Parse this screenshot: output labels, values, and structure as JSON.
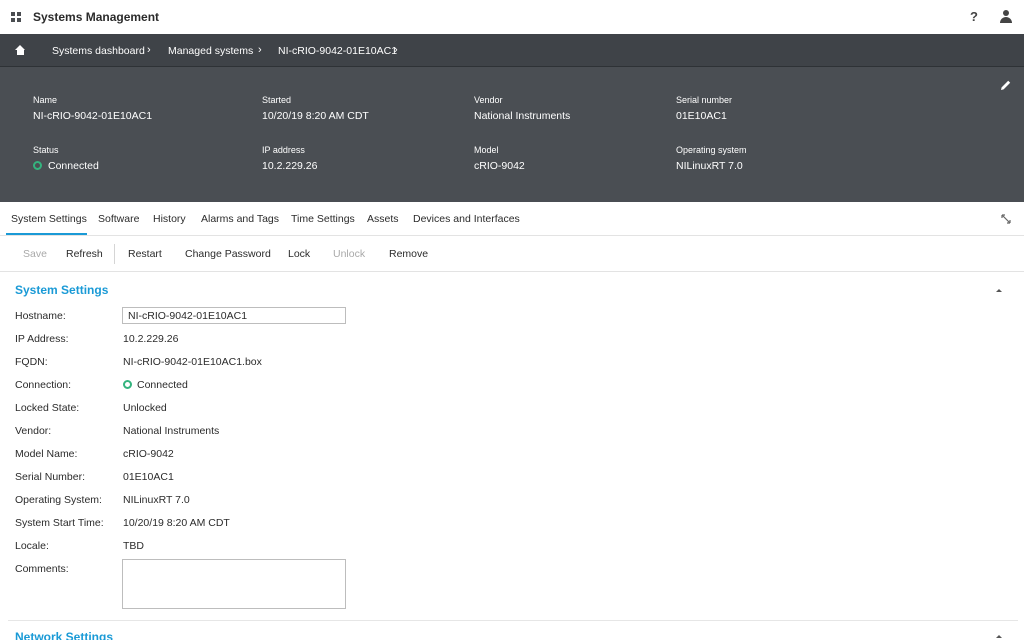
{
  "app": {
    "title": "Systems Management"
  },
  "header": {
    "help_glyph": "?"
  },
  "breadcrumb": [
    {
      "label": "Systems dashboard"
    },
    {
      "label": "Managed systems"
    },
    {
      "label": "NI-cRIO-9042-01E10AC1"
    }
  ],
  "breadcrumb_sep": "›",
  "info": {
    "name_label": "Name",
    "name_value": "NI-cRIO-9042-01E10AC1",
    "started_label": "Started",
    "started_value": "10/20/19 8:20 AM CDT",
    "vendor_label": "Vendor",
    "vendor_value": "National Instruments",
    "serial_label": "Serial number",
    "serial_value": "01E10AC1",
    "status_label": "Status",
    "status_value": "Connected",
    "ip_label": "IP address",
    "ip_value": "10.2.229.26",
    "model_label": "Model",
    "model_value": "cRIO-9042",
    "os_label": "Operating system",
    "os_value": "NILinuxRT 7.0"
  },
  "tabs": [
    {
      "label": "System Settings",
      "active": true
    },
    {
      "label": "Software"
    },
    {
      "label": "History"
    },
    {
      "label": "Alarms and Tags"
    },
    {
      "label": "Time Settings"
    },
    {
      "label": "Assets"
    },
    {
      "label": "Devices and Interfaces"
    }
  ],
  "toolbar": {
    "save": "Save",
    "refresh": "Refresh",
    "restart": "Restart",
    "change_password": "Change Password",
    "lock": "Lock",
    "unlock": "Unlock",
    "remove": "Remove"
  },
  "system_settings": {
    "title": "System Settings",
    "hostname_label": "Hostname:",
    "hostname_value": "NI-cRIO-9042-01E10AC1",
    "ip_label": "IP Address:",
    "ip_value": "10.2.229.26",
    "fqdn_label": "FQDN:",
    "fqdn_value": "NI-cRIO-9042-01E10AC1.box",
    "connection_label": "Connection:",
    "connection_value": "Connected",
    "locked_label": "Locked State:",
    "locked_value": "Unlocked",
    "vendor_label": "Vendor:",
    "vendor_value": "National Instruments",
    "model_label": "Model Name:",
    "model_value": "cRIO-9042",
    "serial_label": "Serial Number:",
    "serial_value": "01E10AC1",
    "os_label": "Operating System:",
    "os_value": "NILinuxRT 7.0",
    "start_label": "System Start Time:",
    "start_value": "10/20/19 8:20 AM CDT",
    "locale_label": "Locale:",
    "locale_value": "TBD",
    "comments_label": "Comments:",
    "comments_value": ""
  },
  "network_settings": {
    "title": "Network Settings"
  },
  "colors": {
    "accent": "#1a9ad6",
    "status_ok": "#34b37e",
    "panel": "#4a4e53",
    "crumbbar": "#3f4348"
  }
}
